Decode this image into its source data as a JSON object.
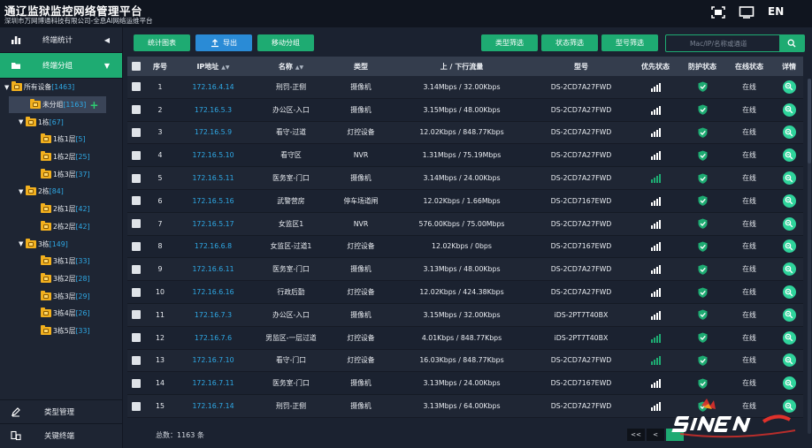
{
  "header": {
    "title": "通辽监狱监控网络管理平台",
    "subtitle": "深圳市万网博通科技有限公司-全息AI网络运维平台",
    "lang": "EN"
  },
  "sidebar": {
    "stats_label": "终端统计",
    "group_label": "终端分组",
    "type_mgmt_label": "类型管理",
    "key_terminal_label": "关键终端",
    "tree": [
      {
        "label": "所有设备",
        "count": "[1463]"
      },
      {
        "label": "未分组",
        "count": "[1163]"
      },
      {
        "label": "1栋",
        "count": "[67]"
      },
      {
        "label": "1栋1层",
        "count": "[5]"
      },
      {
        "label": "1栋2层",
        "count": "[25]"
      },
      {
        "label": "1栋3层",
        "count": "[37]"
      },
      {
        "label": "2栋",
        "count": "[84]"
      },
      {
        "label": "2栋1层",
        "count": "[42]"
      },
      {
        "label": "2栋2层",
        "count": "[42]"
      },
      {
        "label": "3栋",
        "count": "[149]"
      },
      {
        "label": "3栋1层",
        "count": "[33]"
      },
      {
        "label": "3栋2层",
        "count": "[28]"
      },
      {
        "label": "3栋3层",
        "count": "[29]"
      },
      {
        "label": "3栋4层",
        "count": "[26]"
      },
      {
        "label": "3栋5层",
        "count": "[33]"
      }
    ]
  },
  "toolbar": {
    "stats_chart": "统计图表",
    "export": "导出",
    "move_group": "移动分组",
    "type_filter": "类型筛选",
    "status_filter": "状态筛选",
    "model_filter": "型号筛选",
    "search_placeholder": "Mac/IP/名称或通道"
  },
  "table": {
    "headers": [
      "序号",
      "IP地址",
      "名称",
      "类型",
      "上 / 下行流量",
      "型号",
      "优先状态",
      "防护状态",
      "在线状态",
      "详情"
    ],
    "rows": [
      {
        "no": "1",
        "ip": "172.16.4.14",
        "name": "刑罚-正侧",
        "type": "摄像机",
        "traffic": "3.14Mbps / 32.00Kbps",
        "model": "DS-2CD7A27FWD",
        "signal": "white",
        "online": "在线"
      },
      {
        "no": "2",
        "ip": "172.16.5.3",
        "name": "办公区-入口",
        "type": "摄像机",
        "traffic": "3.15Mbps / 48.00Kbps",
        "model": "DS-2CD7A27FWD",
        "signal": "white",
        "online": "在线"
      },
      {
        "no": "3",
        "ip": "172.16.5.9",
        "name": "看守-过道",
        "type": "灯控设备",
        "traffic": "12.02Kbps / 848.77Kbps",
        "model": "DS-2CD7A27FWD",
        "signal": "white",
        "online": "在线"
      },
      {
        "no": "4",
        "ip": "172.16.5.10",
        "name": "看守区",
        "type": "NVR",
        "traffic": "1.31Mbps / 75.19Mbps",
        "model": "DS-2CD7A27FWD",
        "signal": "white",
        "online": "在线"
      },
      {
        "no": "5",
        "ip": "172.16.5.11",
        "name": "医务室-门口",
        "type": "摄像机",
        "traffic": "3.14Mbps / 24.00Kbps",
        "model": "DS-2CD7A27FWD",
        "signal": "green",
        "online": "在线"
      },
      {
        "no": "6",
        "ip": "172.16.5.16",
        "name": "武警营房",
        "type": "停车场道闸",
        "traffic": "12.02Kbps / 1.66Mbps",
        "model": "DS-2CD7167EWD",
        "signal": "white",
        "online": "在线"
      },
      {
        "no": "7",
        "ip": "172.16.5.17",
        "name": "女监区1",
        "type": "NVR",
        "traffic": "576.00Kbps / 75.00Mbps",
        "model": "DS-2CD7A27FWD",
        "signal": "white",
        "online": "在线"
      },
      {
        "no": "8",
        "ip": "172.16.6.8",
        "name": "女监区-过道1",
        "type": "灯控设备",
        "traffic": "12.02Kbps / 0bps",
        "model": "DS-2CD7167EWD",
        "signal": "white",
        "online": "在线"
      },
      {
        "no": "9",
        "ip": "172.16.6.11",
        "name": "医务室-门口",
        "type": "摄像机",
        "traffic": "3.13Mbps / 48.00Kbps",
        "model": "DS-2CD7A27FWD",
        "signal": "white",
        "online": "在线"
      },
      {
        "no": "10",
        "ip": "172.16.6.16",
        "name": "行政后勤",
        "type": "灯控设备",
        "traffic": "12.02Kbps / 424.38Kbps",
        "model": "DS-2CD7A27FWD",
        "signal": "white",
        "online": "在线"
      },
      {
        "no": "11",
        "ip": "172.16.7.3",
        "name": "办公区-入口",
        "type": "摄像机",
        "traffic": "3.15Mbps / 32.00Kbps",
        "model": "iDS-2PT7T40BX",
        "signal": "white",
        "online": "在线"
      },
      {
        "no": "12",
        "ip": "172.16.7.6",
        "name": "男监区-一层过道",
        "type": "灯控设备",
        "traffic": "4.01Kbps / 848.77Kbps",
        "model": "iDS-2PT7T40BX",
        "signal": "green",
        "online": "在线"
      },
      {
        "no": "13",
        "ip": "172.16.7.10",
        "name": "看守-门口",
        "type": "灯控设备",
        "traffic": "16.03Kbps / 848.77Kbps",
        "model": "DS-2CD7A27FWD",
        "signal": "green",
        "online": "在线"
      },
      {
        "no": "14",
        "ip": "172.16.7.11",
        "name": "医务室-门口",
        "type": "摄像机",
        "traffic": "3.13Mbps / 24.00Kbps",
        "model": "DS-2CD7167EWD",
        "signal": "white",
        "online": "在线"
      },
      {
        "no": "15",
        "ip": "172.16.7.14",
        "name": "刑罚-正侧",
        "type": "摄像机",
        "traffic": "3.13Mbps / 64.00Kbps",
        "model": "DS-2CD7A27FWD",
        "signal": "white",
        "online": "在线"
      }
    ]
  },
  "footer": {
    "total": "总数：1163 条",
    "pager_first": "<<",
    "pager_prev": "<"
  },
  "colors": {
    "accent": "#1eab72",
    "link": "#2fa9e6",
    "folder": "#f2b01e"
  }
}
